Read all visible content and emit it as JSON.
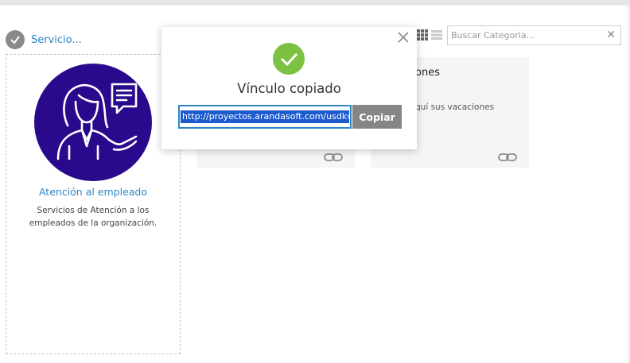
{
  "breadcrumb": {
    "label": "Servicio...",
    "icon": "check-circle-icon"
  },
  "toolbar": {
    "grid_view_icon": "grid-icon",
    "list_view_icon": "list-icon",
    "search": {
      "placeholder": "Buscar Categoria...",
      "value": "",
      "clear_icon": "close-icon"
    }
  },
  "category": {
    "title": "Atención al empleado",
    "description": "Servicios de Atención a los empleados de la organización.",
    "image_icon": "support-agent-illustration",
    "image_bg": "#2a0a8c"
  },
  "services": [
    {
      "title": "",
      "description": "",
      "icon": "link-icon"
    },
    {
      "title": "ones",
      "description": "quí sus vacaciones",
      "icon": "link-icon"
    }
  ],
  "popup": {
    "title": "Vínculo copiado",
    "url": "http://proyectos.arandasoft.com/usdkv",
    "copy_label": "Copiar",
    "success_icon": "check-icon",
    "close_icon": "close-icon",
    "success_color": "#7cc142"
  },
  "colors": {
    "accent": "#2b86c5",
    "highlight": "#1e5bcf"
  }
}
